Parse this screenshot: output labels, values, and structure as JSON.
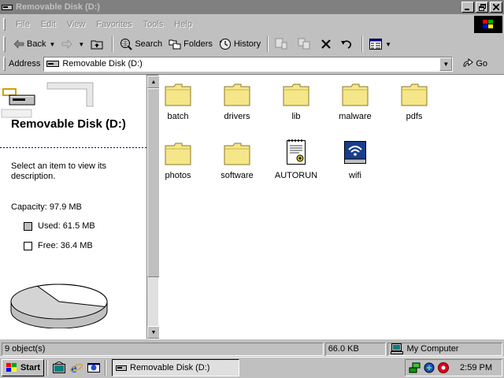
{
  "window": {
    "title": "Removable Disk (D:)",
    "controls": [
      "minimize",
      "maximize",
      "close"
    ]
  },
  "menu": [
    "File",
    "Edit",
    "View",
    "Favorites",
    "Tools",
    "Help"
  ],
  "toolbar": {
    "back": "Back",
    "search": "Search",
    "folders": "Folders",
    "history": "History"
  },
  "address": {
    "label": "Address",
    "value": "Removable Disk (D:)",
    "go": "Go"
  },
  "left_panel": {
    "title": "Removable Disk (D:)",
    "description": "Select an item to view its description.",
    "capacity": "Capacity: 97.9 MB",
    "used": "Used: 61.5 MB",
    "free": "Free: 36.4 MB",
    "used_fraction": 0.628,
    "colors": {
      "used": "#808080",
      "free": "#ffffff"
    }
  },
  "files": [
    {
      "name": "batch",
      "icon": "folder-icon"
    },
    {
      "name": "drivers",
      "icon": "folder-icon"
    },
    {
      "name": "lib",
      "icon": "folder-icon"
    },
    {
      "name": "malware",
      "icon": "folder-icon"
    },
    {
      "name": "pdfs",
      "icon": "folder-icon"
    },
    {
      "name": "photos",
      "icon": "folder-icon"
    },
    {
      "name": "software",
      "icon": "folder-icon"
    },
    {
      "name": "AUTORUN",
      "icon": "setup-info-file-icon"
    },
    {
      "name": "wifi",
      "icon": "wifi-file-icon"
    }
  ],
  "status": {
    "objects": "9 object(s)",
    "size": "66.0 KB",
    "zone": "My Computer"
  },
  "taskbar": {
    "start": "Start",
    "window_button": "Removable Disk (D:)",
    "clock": "2:59 PM"
  },
  "colors": {
    "face": "#c0c0c0",
    "folder": "#f5e68a",
    "inactive_title": "#808080"
  }
}
